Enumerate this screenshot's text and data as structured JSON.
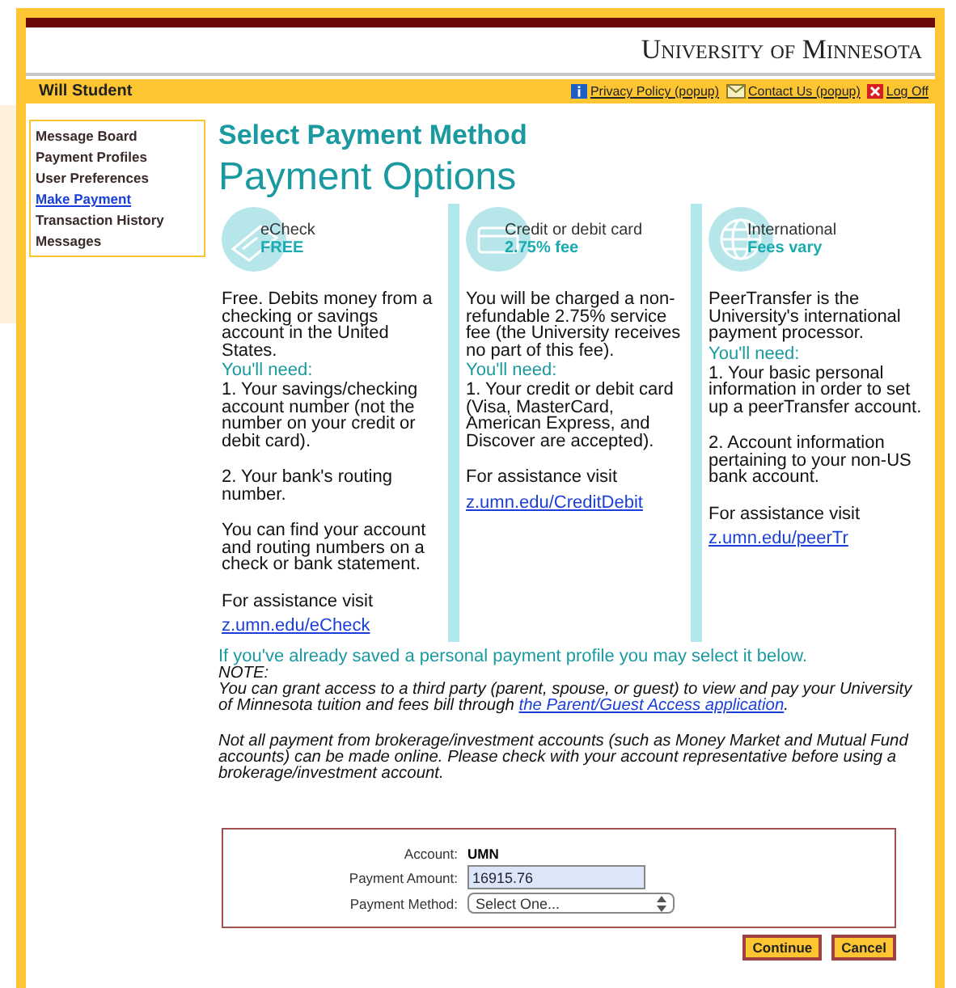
{
  "header": {
    "title": "University of Minnesota"
  },
  "user_bar": {
    "user": "Will Student",
    "links": [
      {
        "kind": "info",
        "label": "Privacy Policy (popup)"
      },
      {
        "kind": "mail",
        "label": "Contact Us (popup)"
      },
      {
        "kind": "close",
        "label": "Log Off"
      }
    ]
  },
  "sidebar": {
    "items": [
      {
        "label": "Message Board",
        "selected": false
      },
      {
        "label": "Payment Profiles",
        "selected": false
      },
      {
        "label": "User Preferences",
        "selected": false
      },
      {
        "label": "Make Payment",
        "selected": true
      },
      {
        "label": "Transaction History",
        "selected": false
      },
      {
        "label": "Messages",
        "selected": false
      }
    ]
  },
  "page_title": "Select Payment Method",
  "section_title": "Payment Options",
  "options": [
    {
      "kind": "check",
      "name": "eCheck",
      "fee": "FREE",
      "description": "Free. Debits money from a checking or savings account in the United States.",
      "need_label": "You'll need:",
      "paragraphs": [
        "1. Your savings/checking account number (not the number on your credit or debit card).",
        "2. Your bank's routing number.",
        "You can find your account and routing numbers on a check or bank statement."
      ],
      "assistance": "For assistance visit",
      "link": "z.umn.edu/eCheck"
    },
    {
      "kind": "card",
      "name": "Credit or debit card",
      "fee": "2.75% fee",
      "description": "You will be charged a non-refundable 2.75% service fee (the University receives no part of this fee).",
      "need_label": "You'll need:",
      "paragraphs": [
        "1. Your credit or debit card (Visa, MasterCard, American Express, and Discover are accepted)."
      ],
      "assistance": "For assistance visit",
      "link": "z.umn.edu/CreditDebit"
    },
    {
      "kind": "globe",
      "name": "International",
      "fee": "Fees vary",
      "description": "PeerTransfer is the University's international payment processor.",
      "need_label": "You'll need:",
      "paragraphs": [
        "1. Your basic personal information in order to set up a peerTransfer account.",
        "2. Account information pertaining to your non-US bank account."
      ],
      "assistance": "For assistance visit",
      "link": "z.umn.edu/peerTr"
    }
  ],
  "profile_hint": "If you've already saved a personal payment profile you may select it below.",
  "note": {
    "label": "NOTE:",
    "text": "You can grant access to a third party (parent, spouse, or guest) to view and pay your University of Minnesota tuition and fees bill through",
    "link": "the Parent/Guest Access application",
    "after": ".",
    "warning": "Not all payment from brokerage/investment accounts (such as Money Market and Mutual Fund accounts) can be made online. Please check with your account representative before using a brokerage/investment account."
  },
  "form": {
    "account_label": "Account:",
    "account": "UMN",
    "amount_label": "Payment Amount:",
    "amount": "16915.76",
    "method_label": "Payment Method:",
    "method": "Select One..."
  },
  "buttons": [
    "Continue",
    "Cancel"
  ]
}
